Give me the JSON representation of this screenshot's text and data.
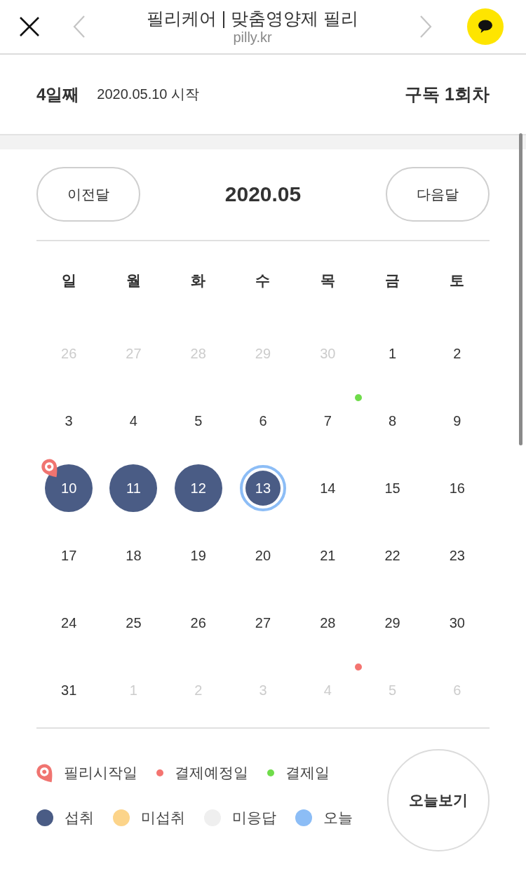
{
  "browser": {
    "title": "필리케어 | 맞춤영양제 필리",
    "url": "pilly.kr"
  },
  "summary": {
    "day": "4일째",
    "start": "2020.05.10 시작",
    "subscription": "구독 1회차"
  },
  "calendar": {
    "prev": "이전달",
    "month": "2020.05",
    "next": "다음달",
    "weekdays": [
      "일",
      "월",
      "화",
      "수",
      "목",
      "금",
      "토"
    ],
    "weeks": [
      [
        {
          "label": "26",
          "in_month": false,
          "taken": false,
          "today": false
        },
        {
          "label": "27",
          "in_month": false,
          "taken": false,
          "today": false
        },
        {
          "label": "28",
          "in_month": false,
          "taken": false,
          "today": false
        },
        {
          "label": "29",
          "in_month": false,
          "taken": false,
          "today": false
        },
        {
          "label": "30",
          "in_month": false,
          "taken": false,
          "today": false
        },
        {
          "label": "1",
          "in_month": true,
          "taken": false,
          "today": false
        },
        {
          "label": "2",
          "in_month": true,
          "taken": false,
          "today": false
        }
      ],
      [
        {
          "label": "3",
          "in_month": true,
          "taken": false,
          "today": false
        },
        {
          "label": "4",
          "in_month": true,
          "taken": false,
          "today": false
        },
        {
          "label": "5",
          "in_month": true,
          "taken": false,
          "today": false
        },
        {
          "label": "6",
          "in_month": true,
          "taken": false,
          "today": false
        },
        {
          "label": "7",
          "in_month": true,
          "taken": false,
          "today": false
        },
        {
          "label": "8",
          "in_month": true,
          "taken": false,
          "today": false,
          "marker": {
            "kind": "dot",
            "color": "#6fdc4a"
          }
        },
        {
          "label": "9",
          "in_month": true,
          "taken": false,
          "today": false
        }
      ],
      [
        {
          "label": "10",
          "in_month": true,
          "taken": true,
          "today": false,
          "marker": {
            "kind": "pin"
          }
        },
        {
          "label": "11",
          "in_month": true,
          "taken": true,
          "today": false
        },
        {
          "label": "12",
          "in_month": true,
          "taken": true,
          "today": false
        },
        {
          "label": "13",
          "in_month": true,
          "taken": true,
          "today": true
        },
        {
          "label": "14",
          "in_month": true,
          "taken": false,
          "today": false
        },
        {
          "label": "15",
          "in_month": true,
          "taken": false,
          "today": false
        },
        {
          "label": "16",
          "in_month": true,
          "taken": false,
          "today": false
        }
      ],
      [
        {
          "label": "17",
          "in_month": true,
          "taken": false,
          "today": false
        },
        {
          "label": "18",
          "in_month": true,
          "taken": false,
          "today": false
        },
        {
          "label": "19",
          "in_month": true,
          "taken": false,
          "today": false
        },
        {
          "label": "20",
          "in_month": true,
          "taken": false,
          "today": false
        },
        {
          "label": "21",
          "in_month": true,
          "taken": false,
          "today": false
        },
        {
          "label": "22",
          "in_month": true,
          "taken": false,
          "today": false
        },
        {
          "label": "23",
          "in_month": true,
          "taken": false,
          "today": false
        }
      ],
      [
        {
          "label": "24",
          "in_month": true,
          "taken": false,
          "today": false
        },
        {
          "label": "25",
          "in_month": true,
          "taken": false,
          "today": false
        },
        {
          "label": "26",
          "in_month": true,
          "taken": false,
          "today": false
        },
        {
          "label": "27",
          "in_month": true,
          "taken": false,
          "today": false
        },
        {
          "label": "28",
          "in_month": true,
          "taken": false,
          "today": false
        },
        {
          "label": "29",
          "in_month": true,
          "taken": false,
          "today": false
        },
        {
          "label": "30",
          "in_month": true,
          "taken": false,
          "today": false
        }
      ],
      [
        {
          "label": "31",
          "in_month": true,
          "taken": false,
          "today": false
        },
        {
          "label": "1",
          "in_month": false,
          "taken": false,
          "today": false
        },
        {
          "label": "2",
          "in_month": false,
          "taken": false,
          "today": false
        },
        {
          "label": "3",
          "in_month": false,
          "taken": false,
          "today": false
        },
        {
          "label": "4",
          "in_month": false,
          "taken": false,
          "today": false
        },
        {
          "label": "5",
          "in_month": false,
          "taken": false,
          "today": false,
          "marker": {
            "kind": "dot",
            "color": "#f47470"
          }
        },
        {
          "label": "6",
          "in_month": false,
          "taken": false,
          "today": false
        }
      ]
    ]
  },
  "legend_rows": [
    [
      {
        "kind": "pin",
        "label": "필리시작일",
        "color": "#f07470"
      },
      {
        "kind": "dot",
        "label": "결제예정일",
        "color": "#f47470"
      },
      {
        "kind": "dot",
        "label": "결제일",
        "color": "#6fdc4a"
      }
    ],
    [
      {
        "kind": "circle",
        "label": "섭취",
        "color": "#4a5c85"
      },
      {
        "kind": "circle",
        "label": "미섭취",
        "color": "#fcd48a"
      },
      {
        "kind": "circle",
        "label": "미응답",
        "color": "#efefef"
      },
      {
        "kind": "circle",
        "label": "오늘",
        "color": "#8cbdf6"
      }
    ]
  ],
  "today_button": "오늘보기"
}
